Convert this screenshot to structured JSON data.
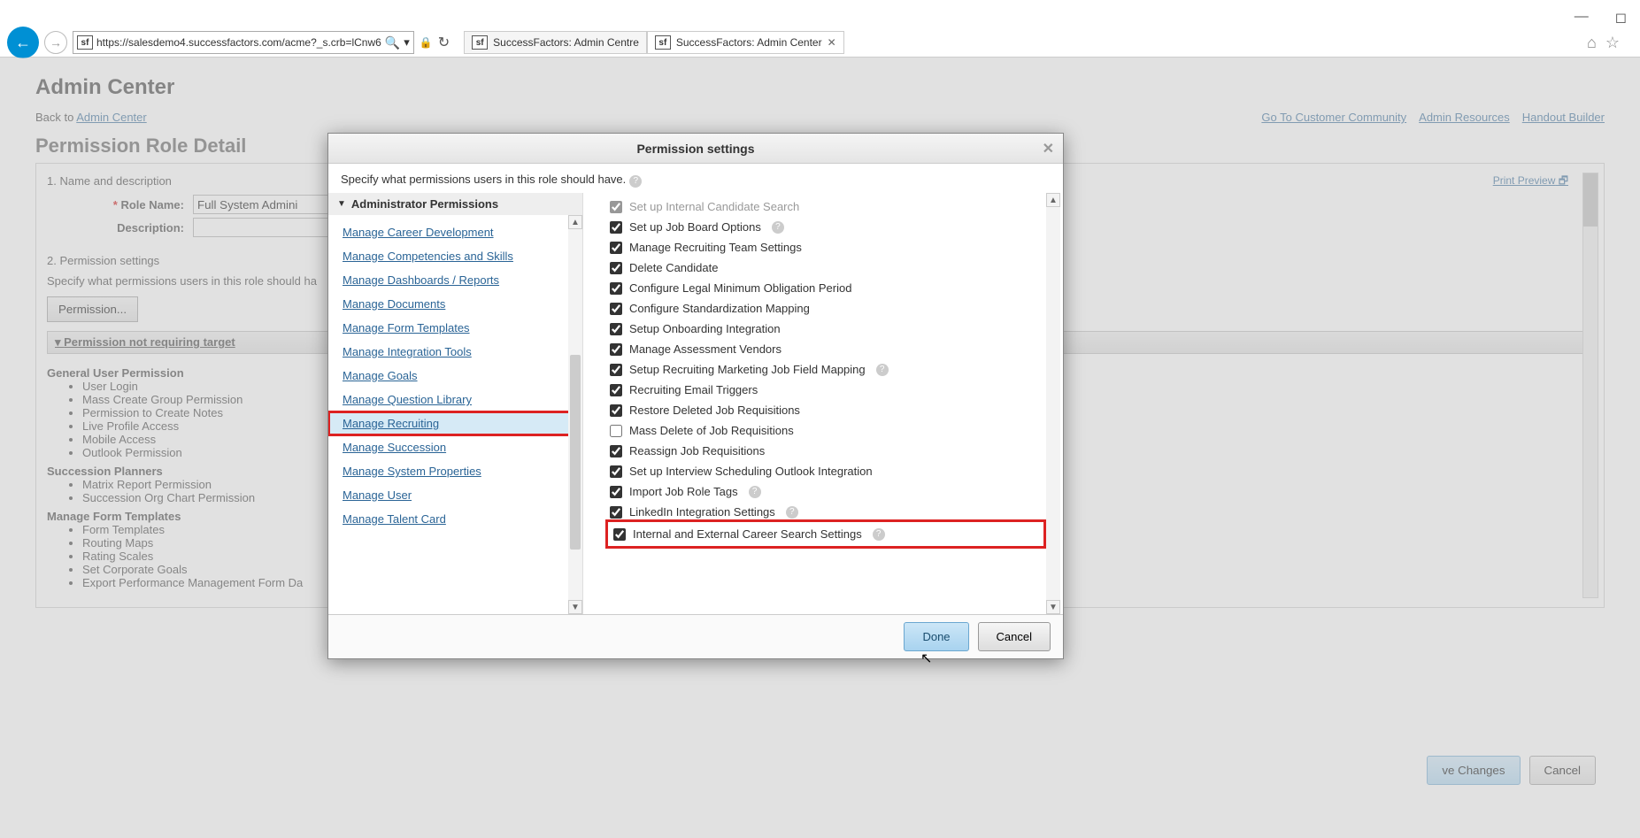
{
  "window": {
    "minimize": "—",
    "maximize": "◻",
    "close": ""
  },
  "browser": {
    "url": "https://salesdemo4.successfactors.com/acme?_s.crb=lCnw6",
    "tabs": [
      {
        "label": "SuccessFactors: Admin Centre",
        "active": false
      },
      {
        "label": "SuccessFactors: Admin Center",
        "active": true
      }
    ]
  },
  "page": {
    "title": "Admin Center",
    "back_prefix": "Back to ",
    "back_link": "Admin Center",
    "top_links": [
      "Go To Customer Community",
      "Admin Resources",
      "Handout Builder"
    ],
    "section_title": "Permission Role Detail",
    "print_preview": "Print Preview",
    "step1_label": "1. Name and description",
    "role_name_label": "Role Name:",
    "role_name_value": "Full System Admini",
    "desc_label": "Description:",
    "desc_value": "",
    "step2_label": "2. Permission settings",
    "step2_instr": "Specify what permissions users in this role should ha",
    "perm_button": "Permission...",
    "collapse_label": "Permission not requiring target",
    "tree": {
      "g1": {
        "title": "General User Permission",
        "items": [
          "User Login",
          "Mass Create Group Permission",
          "Permission to Create Notes",
          "Live Profile Access",
          "Mobile Access",
          "Outlook Permission"
        ]
      },
      "g2": {
        "title": "Succession Planners",
        "items": [
          "Matrix Report Permission",
          "Succession Org Chart Permission"
        ]
      },
      "g3": {
        "title": "Manage Form Templates",
        "items": [
          "Form Templates",
          "Routing Maps",
          "Rating Scales",
          "Set Corporate Goals",
          "Export Performance Management Form Da"
        ]
      }
    },
    "save_label": "ve Changes",
    "cancel_label": "Cancel"
  },
  "modal": {
    "title": "Permission settings",
    "instr": "Specify what permissions users in this role should have.",
    "cat_header": "Administrator Permissions",
    "categories": [
      "Manage Career Development",
      "Manage Competencies and Skills",
      "Manage Dashboards / Reports",
      "Manage Documents",
      "Manage Form Templates",
      "Manage Integration Tools",
      "Manage Goals",
      "Manage Question Library",
      "Manage Recruiting",
      "Manage Succession",
      "Manage System Properties",
      "Manage User",
      "Manage Talent Card"
    ],
    "selected_category_index": 8,
    "permissions": [
      {
        "label": "Set up Internal Candidate Search",
        "checked": true,
        "help": false,
        "cutoff": true
      },
      {
        "label": "Set up Job Board Options",
        "checked": true,
        "help": true
      },
      {
        "label": "Manage Recruiting Team Settings",
        "checked": true,
        "help": false
      },
      {
        "label": "Delete Candidate",
        "checked": true,
        "help": false
      },
      {
        "label": "Configure Legal Minimum Obligation Period",
        "checked": true,
        "help": false
      },
      {
        "label": "Configure Standardization Mapping",
        "checked": true,
        "help": false
      },
      {
        "label": "Setup Onboarding Integration",
        "checked": true,
        "help": false
      },
      {
        "label": "Manage Assessment Vendors",
        "checked": true,
        "help": false
      },
      {
        "label": "Setup Recruiting Marketing Job Field Mapping",
        "checked": true,
        "help": true
      },
      {
        "label": "Recruiting Email Triggers",
        "checked": true,
        "help": false
      },
      {
        "label": "Restore Deleted Job Requisitions",
        "checked": true,
        "help": false
      },
      {
        "label": "Mass Delete of Job Requisitions",
        "checked": false,
        "help": false
      },
      {
        "label": "Reassign Job Requisitions",
        "checked": true,
        "help": false
      },
      {
        "label": "Set up Interview Scheduling Outlook Integration",
        "checked": true,
        "help": false
      },
      {
        "label": "Import Job Role Tags",
        "checked": true,
        "help": true
      },
      {
        "label": "LinkedIn Integration Settings",
        "checked": true,
        "help": true
      },
      {
        "label": "Internal and External Career Search Settings",
        "checked": true,
        "help": true,
        "highlighted": true
      }
    ],
    "done_label": "Done",
    "cancel_label": "Cancel"
  }
}
